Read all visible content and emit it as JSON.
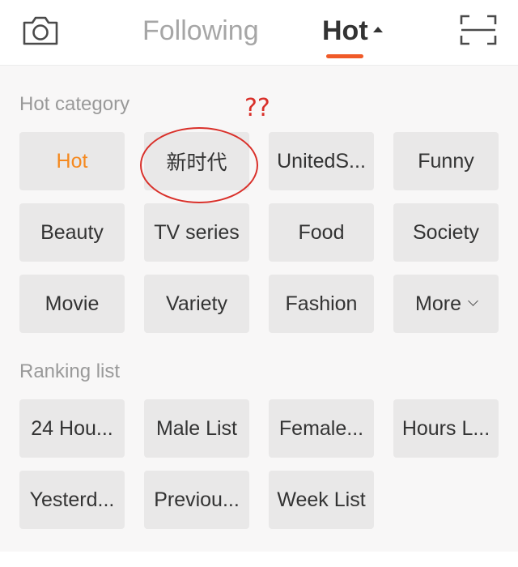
{
  "header": {
    "tabs": [
      {
        "label": "Following"
      },
      {
        "label": "Hot"
      }
    ],
    "accent_color": "#f05a28"
  },
  "hot_category": {
    "title": "Hot category",
    "items": [
      {
        "label": "Hot",
        "selected": true
      },
      {
        "label": "新时代"
      },
      {
        "label": "UnitedS..."
      },
      {
        "label": "Funny"
      },
      {
        "label": "Beauty"
      },
      {
        "label": "TV series"
      },
      {
        "label": "Food"
      },
      {
        "label": "Society"
      },
      {
        "label": "Movie"
      },
      {
        "label": "Variety"
      },
      {
        "label": "Fashion"
      },
      {
        "label": "More"
      }
    ]
  },
  "ranking_list": {
    "title": "Ranking list",
    "items": [
      {
        "label": "24 Hou..."
      },
      {
        "label": "Male List"
      },
      {
        "label": "Female..."
      },
      {
        "label": "Hours L..."
      },
      {
        "label": "Yesterd..."
      },
      {
        "label": "Previou..."
      },
      {
        "label": "Week List"
      }
    ]
  },
  "annotation": {
    "text": "??",
    "color": "#d9302a"
  },
  "colors": {
    "selected_chip_text": "#f5891f",
    "chip_bg": "#e9e8e8",
    "panel_bg": "#f8f7f7"
  }
}
